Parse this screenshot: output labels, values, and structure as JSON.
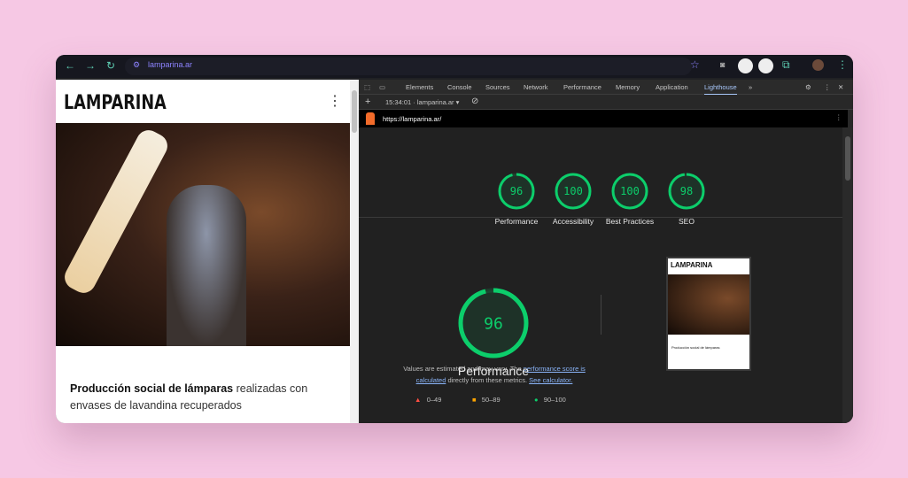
{
  "browser": {
    "url": "lamparina.ar"
  },
  "page": {
    "logo": "LAMPARINA",
    "headline_bold": "Producción social de lámparas",
    "headline_rest": " realizadas con envases de lavandina recuperados"
  },
  "devtools": {
    "tabs": [
      "Elements",
      "Console",
      "Sources",
      "Network",
      "Performance",
      "Memory",
      "Application",
      "Lighthouse"
    ],
    "active_tab": "Lighthouse",
    "report_selector": "15:34:01 · lamparina.ar",
    "report_url": "https://lamparina.ar/",
    "scores": [
      {
        "label": "Performance",
        "value": 96
      },
      {
        "label": "Accessibility",
        "value": 100
      },
      {
        "label": "Best Practices",
        "value": 100
      },
      {
        "label": "SEO",
        "value": 98
      }
    ],
    "main_score": {
      "label": "Performance",
      "value": 96
    },
    "description": {
      "text1": "Values are estimated and may vary. The ",
      "link1": "performance score is calculated",
      "text2": " directly from these metrics. ",
      "link2": "See calculator."
    },
    "legend": [
      "0–49",
      "50–89",
      "90–100"
    ],
    "colors": {
      "pass": "#0cce6b",
      "average": "#ffa400",
      "fail": "#ff4e42"
    }
  }
}
